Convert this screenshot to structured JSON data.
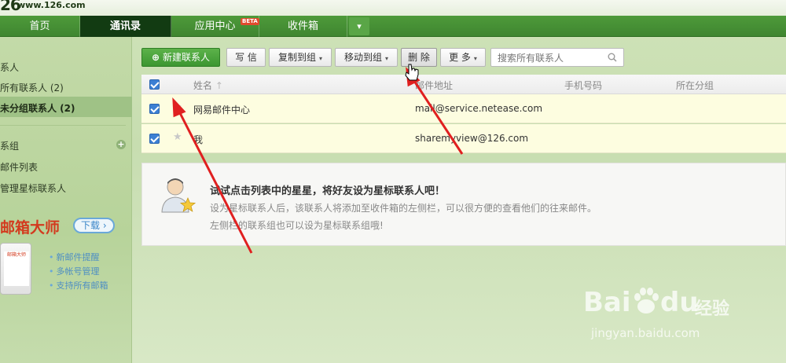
{
  "header": {
    "logo": "26",
    "logo_url": "www.126.com"
  },
  "nav": {
    "tabs": [
      {
        "label": "首页"
      },
      {
        "label": "通讯录"
      },
      {
        "label": "应用中心",
        "badge": "BETA"
      },
      {
        "label": "收件箱"
      }
    ],
    "more_icon": "chevron-down-icon"
  },
  "sidebar": {
    "section_contacts": "系人",
    "item_all": "所有联系人 (2)",
    "item_ungrouped": "未分组联系人 (2)",
    "section_groups": "系组",
    "item_mail_list": "邮件列表",
    "item_manage_star": "管理星标联系人",
    "promo_title": "邮箱大师",
    "promo_download": "下载",
    "promo_phone_label": "邮箱大师",
    "features": [
      "新邮件提醒",
      "多帐号管理",
      "支持所有邮箱"
    ]
  },
  "toolbar": {
    "new_contact": "新建联系人",
    "write": "写 信",
    "copy_to_group": "复制到组",
    "move_to_group": "移动到组",
    "delete": "删 除",
    "more": "更 多",
    "search_placeholder": "搜索所有联系人"
  },
  "table": {
    "headers": {
      "name": "姓名",
      "name_sort": "↑",
      "email": "邮件地址",
      "phone": "手机号码",
      "group": "所在分组"
    },
    "rows": [
      {
        "name": "网易邮件中心",
        "email": "mail@service.netease.com",
        "checked": true
      },
      {
        "name": "我",
        "email": "sharemyview@126.com",
        "checked": true
      }
    ]
  },
  "notice": {
    "title": "试试点击列表中的星星，将好友设为星标联系人吧！",
    "line1": "设为星标联系人后，该联系人将添加至收件箱的左侧栏，可以很方便的查看他们的往来邮件。",
    "line2": "左侧栏的联系组也可以设为星标联系组哦!"
  },
  "watermark": {
    "brand": "Bai",
    "brand2": "du",
    "cn": "经验",
    "url": "jingyan.baidu.com"
  },
  "colors": {
    "accent_green": "#3f8630",
    "active_tab": "#123b12",
    "row_highlight": "#fdfde0",
    "annotation_red": "#e02020"
  }
}
